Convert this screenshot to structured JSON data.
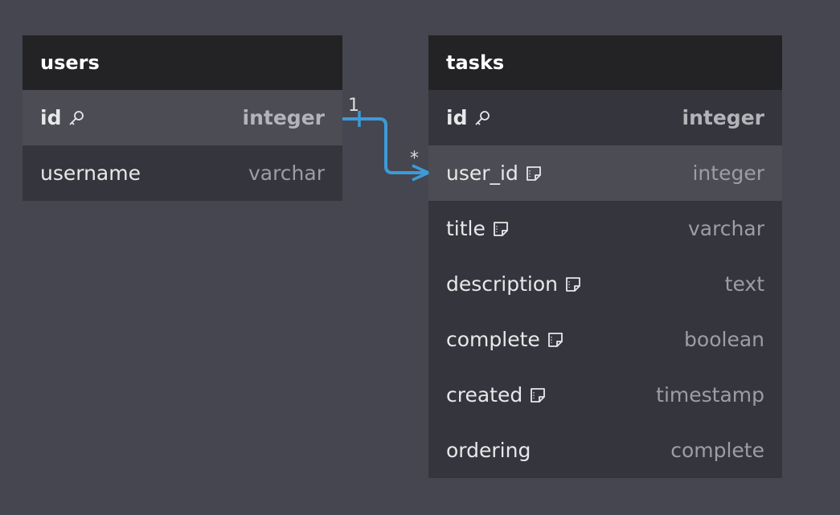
{
  "tables": {
    "users": {
      "title": "users",
      "fields": [
        {
          "name": "id",
          "type": "integer",
          "icon": "key-icon"
        },
        {
          "name": "username",
          "type": "varchar"
        }
      ]
    },
    "tasks": {
      "title": "tasks",
      "fields": [
        {
          "name": "id",
          "type": "integer",
          "icon": "key-icon"
        },
        {
          "name": "user_id",
          "type": "integer",
          "icon": "note-icon"
        },
        {
          "name": "title",
          "type": "varchar",
          "icon": "note-icon"
        },
        {
          "name": "description",
          "type": "text",
          "icon": "note-icon"
        },
        {
          "name": "complete",
          "type": "boolean",
          "icon": "note-icon"
        },
        {
          "name": "created",
          "type": "timestamp",
          "icon": "note-icon"
        },
        {
          "name": "ordering",
          "type": "complete"
        }
      ]
    }
  },
  "relationship": {
    "from": "users.id",
    "to": "tasks.user_id",
    "from_cardinality": "1",
    "to_cardinality": "*",
    "color": "#3d9ad9"
  },
  "colors": {
    "background": "#45464f",
    "header": "#232325",
    "row": "#35363d",
    "row_highlight": "#4b4c54"
  }
}
